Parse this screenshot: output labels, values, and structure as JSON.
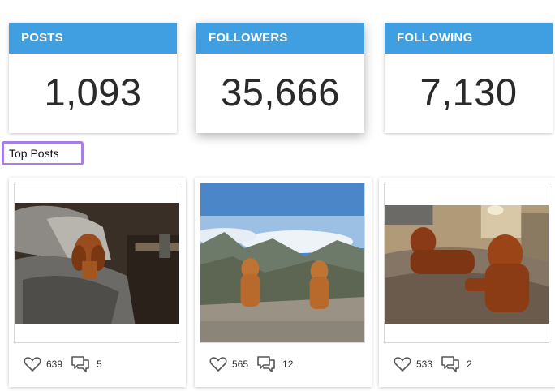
{
  "stats": [
    {
      "label": "POSTS",
      "value": "1,093"
    },
    {
      "label": "FOLLOWERS",
      "value": "35,666"
    },
    {
      "label": "FOLLOWING",
      "value": "7,130"
    }
  ],
  "section_title": "Top Posts",
  "posts": [
    {
      "likes": "639",
      "comments": "5"
    },
    {
      "likes": "565",
      "comments": "12"
    },
    {
      "likes": "533",
      "comments": "2"
    }
  ],
  "colors": {
    "accent": "#3f9fe0",
    "highlight": "#a77de6"
  }
}
